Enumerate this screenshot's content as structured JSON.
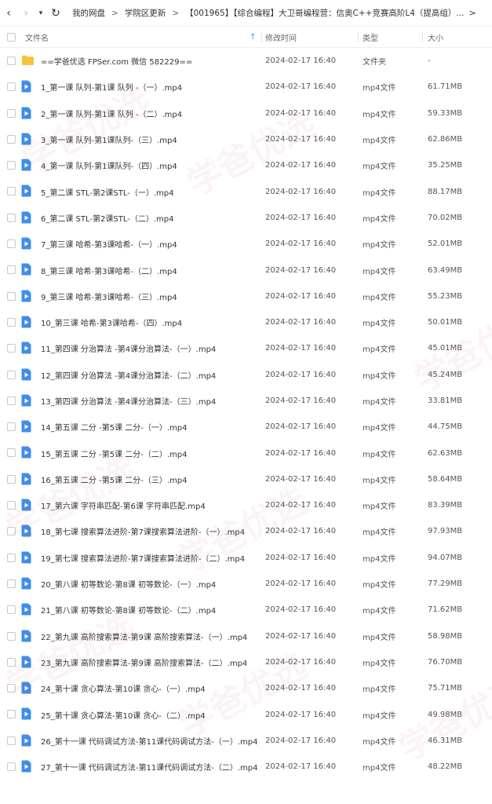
{
  "toolbar": {
    "back_glyph": "‹",
    "forward_glyph": "›",
    "history_glyph": "▾",
    "refresh_glyph": "↻",
    "breadcrumbs": [
      "我的网盘",
      "学院区更新",
      "【001965】【综合编程】大卫哥编程营：信奥C++竞赛高阶L4（提高组）..."
    ],
    "separator": ">",
    "end_arrow": ">"
  },
  "header": {
    "name": "文件名",
    "sort_indicator": "↑",
    "date": "修改时间",
    "type": "类型",
    "size": "大小"
  },
  "colors": {
    "folder": "#f7c33c",
    "video": "#3f8ee9",
    "sort": "#3a8cff"
  },
  "watermark": {
    "text": "学爸优选"
  },
  "files": [
    {
      "icon": "folder-icon",
      "name": "==学爸优选 FPSer.com 微信 582229==",
      "date": "2024-02-17 16:40",
      "type": "文件夹",
      "size": "-"
    },
    {
      "icon": "video-file-icon",
      "name": "1_第一课 队列-第1课 队列 -（一）.mp4",
      "date": "2024-02-17 16:40",
      "type": "mp4文件",
      "size": "61.71MB"
    },
    {
      "icon": "video-file-icon",
      "name": "2_第一课 队列-第1课 队列 -（二）.mp4",
      "date": "2024-02-17 16:40",
      "type": "mp4文件",
      "size": "59.33MB"
    },
    {
      "icon": "video-file-icon",
      "name": "3_第一课 队列-第1课队列-（三）.mp4",
      "date": "2024-02-17 16:40",
      "type": "mp4文件",
      "size": "62.86MB"
    },
    {
      "icon": "video-file-icon",
      "name": "4_第一课 队列-第1课队列-（四）.mp4",
      "date": "2024-02-17 16:40",
      "type": "mp4文件",
      "size": "35.25MB"
    },
    {
      "icon": "video-file-icon",
      "name": "5_第二课 STL-第2课STL-（一）.mp4",
      "date": "2024-02-17 16:40",
      "type": "mp4文件",
      "size": "88.17MB"
    },
    {
      "icon": "video-file-icon",
      "name": "6_第二课 STL-第2课STL-（二）.mp4",
      "date": "2024-02-17 16:40",
      "type": "mp4文件",
      "size": "70.02MB"
    },
    {
      "icon": "video-file-icon",
      "name": "7_第三课 哈希-第3课哈希-（一）.mp4",
      "date": "2024-02-17 16:40",
      "type": "mp4文件",
      "size": "52.01MB"
    },
    {
      "icon": "video-file-icon",
      "name": "8_第三课 哈希-第3课哈希-（二）.mp4",
      "date": "2024-02-17 16:40",
      "type": "mp4文件",
      "size": "63.49MB"
    },
    {
      "icon": "video-file-icon",
      "name": "9_第三课 哈希-第3课哈希-（三）.mp4",
      "date": "2024-02-17 16:40",
      "type": "mp4文件",
      "size": "55.23MB"
    },
    {
      "icon": "video-file-icon",
      "name": "10_第三课 哈希-第3课哈希-（四）.mp4",
      "date": "2024-02-17 16:40",
      "type": "mp4文件",
      "size": "50.01MB"
    },
    {
      "icon": "video-file-icon",
      "name": "11_第四课 分治算法 -第4课分治算法-（一）.mp4",
      "date": "2024-02-17 16:40",
      "type": "mp4文件",
      "size": "45.01MB"
    },
    {
      "icon": "video-file-icon",
      "name": "12_第四课 分治算法 -第4课分治算法-（二）.mp4",
      "date": "2024-02-17 16:40",
      "type": "mp4文件",
      "size": "45.24MB"
    },
    {
      "icon": "video-file-icon",
      "name": "13_第四课 分治算法 -第4课分治算法-（三）.mp4",
      "date": "2024-02-17 16:40",
      "type": "mp4文件",
      "size": "33.81MB"
    },
    {
      "icon": "video-file-icon",
      "name": "14_第五课 二分 -第5课 二分-（一）.mp4",
      "date": "2024-02-17 16:40",
      "type": "mp4文件",
      "size": "44.75MB"
    },
    {
      "icon": "video-file-icon",
      "name": "15_第五课 二分 -第5课 二分-（二）.mp4",
      "date": "2024-02-17 16:40",
      "type": "mp4文件",
      "size": "62.63MB"
    },
    {
      "icon": "video-file-icon",
      "name": "16_第五课 二分 -第5课 二分-（三）.mp4",
      "date": "2024-02-17 16:40",
      "type": "mp4文件",
      "size": "58.64MB"
    },
    {
      "icon": "video-file-icon",
      "name": "17_第六课 字符串匹配-第6课 字符串匹配.mp4",
      "date": "2024-02-17 16:40",
      "type": "mp4文件",
      "size": "83.39MB"
    },
    {
      "icon": "video-file-icon",
      "name": "18_第七课 搜索算法进阶-第7课搜索算法进阶-（一）.mp4",
      "date": "2024-02-17 16:40",
      "type": "mp4文件",
      "size": "97.93MB"
    },
    {
      "icon": "video-file-icon",
      "name": "19_第七课 搜索算法进阶-第7课搜索算法进阶-（二）.mp4",
      "date": "2024-02-17 16:40",
      "type": "mp4文件",
      "size": "94.07MB"
    },
    {
      "icon": "video-file-icon",
      "name": "20_第八课 初等数论-第8课 初等数论-（一）.mp4",
      "date": "2024-02-17 16:40",
      "type": "mp4文件",
      "size": "77.29MB"
    },
    {
      "icon": "video-file-icon",
      "name": "21_第八课 初等数论-第8课 初等数论-（二）.mp4",
      "date": "2024-02-17 16:40",
      "type": "mp4文件",
      "size": "71.62MB"
    },
    {
      "icon": "video-file-icon",
      "name": "22_第九课 高阶搜索算法-第9课 高阶搜索算法-（一）.mp4",
      "date": "2024-02-17 16:40",
      "type": "mp4文件",
      "size": "58.98MB"
    },
    {
      "icon": "video-file-icon",
      "name": "23_第九课 高阶搜索算法-第9课 高阶搜索算法-（二）.mp4",
      "date": "2024-02-17 16:40",
      "type": "mp4文件",
      "size": "76.70MB"
    },
    {
      "icon": "video-file-icon",
      "name": "24_第十课 贪心算法-第10课 贪心-（一）.mp4",
      "date": "2024-02-17 16:40",
      "type": "mp4文件",
      "size": "75.71MB"
    },
    {
      "icon": "video-file-icon",
      "name": "25_第十课 贪心算法-第10课 贪心-（二）.mp4",
      "date": "2024-02-17 16:40",
      "type": "mp4文件",
      "size": "49.98MB"
    },
    {
      "icon": "video-file-icon",
      "name": "26_第十一课 代码调试方法-第11课代码调试方法-（一）.mp4",
      "date": "2024-02-17 16:40",
      "type": "mp4文件",
      "size": "46.31MB"
    },
    {
      "icon": "video-file-icon",
      "name": "27_第十一课 代码调试方法-第11课代码调试方法-（二）.mp4",
      "date": "2024-02-17 16:40",
      "type": "mp4文件",
      "size": "48.22MB"
    }
  ]
}
